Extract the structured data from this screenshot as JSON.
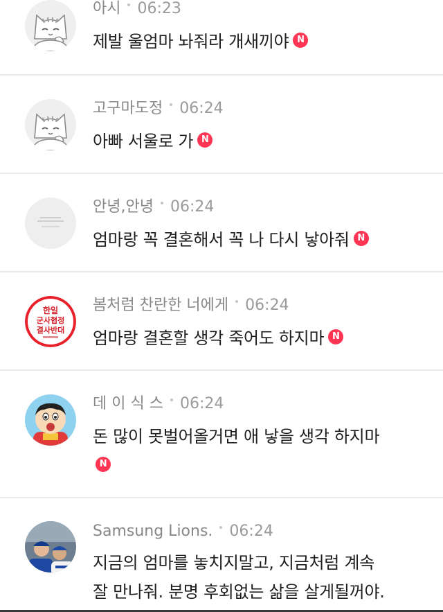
{
  "comments": [
    {
      "nickname": "아시",
      "time": "06:23",
      "text": "제발 울엄마 놔줘라 개새끼야",
      "badge": "N",
      "avatar": "cat-avatar"
    },
    {
      "nickname": "고구마도정",
      "time": "06:24",
      "text": "아빠 서울로 가",
      "badge": "N",
      "avatar": "cat-avatar"
    },
    {
      "nickname": "안녕,안녕",
      "time": "06:24",
      "text": "엄마랑 꼭 결혼해서 꼭 나 다시 낳아줘",
      "badge": "N",
      "avatar": "grey-text-avatar"
    },
    {
      "nickname": "봄처럼 찬란한 너에게",
      "time": "06:24",
      "text": "엄마랑 결혼할 생각 죽어도 하지마",
      "badge": "N",
      "avatar": "protest-sticker-avatar",
      "avatar_text": [
        "한일",
        "군사협정",
        "결사반대"
      ]
    },
    {
      "nickname": "데 이 식 스",
      "time": "06:24",
      "text": "돈 많이 못벌어올거면 애 낳을 생각 하지마",
      "badge": "N",
      "avatar": "cartoon-boy-avatar"
    },
    {
      "nickname": "Samsung Lions.",
      "time": "06:24",
      "text_line1": "지금의 엄마를 놓치지말고, 지금처럼 계속",
      "text_line2": "잘 만나줘. 분명 후회없는 삶을 살게될꺼야.",
      "avatar": "baseball-players-avatar"
    }
  ],
  "colors": {
    "nickname": "#888888",
    "time": "#9a9a9a",
    "text": "#1e1e1e",
    "badge": "#ff3553",
    "divider": "#e9e9e9"
  }
}
